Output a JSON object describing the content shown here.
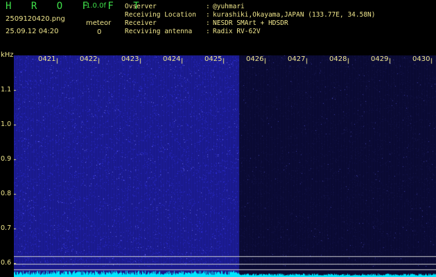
{
  "header": {
    "logo": "H R O F F T",
    "version": "1.0.0f",
    "filename": "2509120420.png",
    "datetime": "25.09.12 04:20",
    "meteor_label": "meteor",
    "meteor_count": "0"
  },
  "station_info": [
    {
      "key": "Ovserver",
      "value": "@yuhmari"
    },
    {
      "key": "Receiving Location",
      "value": "kurashiki,Okayama,JAPAN (133.77E, 34.58N)"
    },
    {
      "key": "Receiver",
      "value": "NESDR SMArt + HDSDR"
    },
    {
      "key": "Recviving antenna",
      "value": "Radix RV-62V"
    }
  ],
  "info_separator": ":",
  "colors": {
    "logo": "#3fe04a",
    "text": "#f0e68c",
    "spectrum_bright": "#1a1a8c",
    "spectrum_dark": "#0a0a33",
    "trace": "#00e5ff",
    "marker_lines": "#cfcfcf"
  },
  "chart_data": {
    "type": "heatmap",
    "ylabel": "kHz",
    "y_ticks": [
      "1.1",
      "1.0",
      "0.9",
      "0.8",
      "0.7",
      "0.6"
    ],
    "x_ticks": [
      "0421",
      "0422",
      "0423",
      "0424",
      "0425",
      "0426",
      "0427",
      "0428",
      "0429",
      "0430"
    ],
    "bright_until": "0425",
    "marker_lines_khz": [
      0.62,
      0.59,
      0.58
    ]
  }
}
